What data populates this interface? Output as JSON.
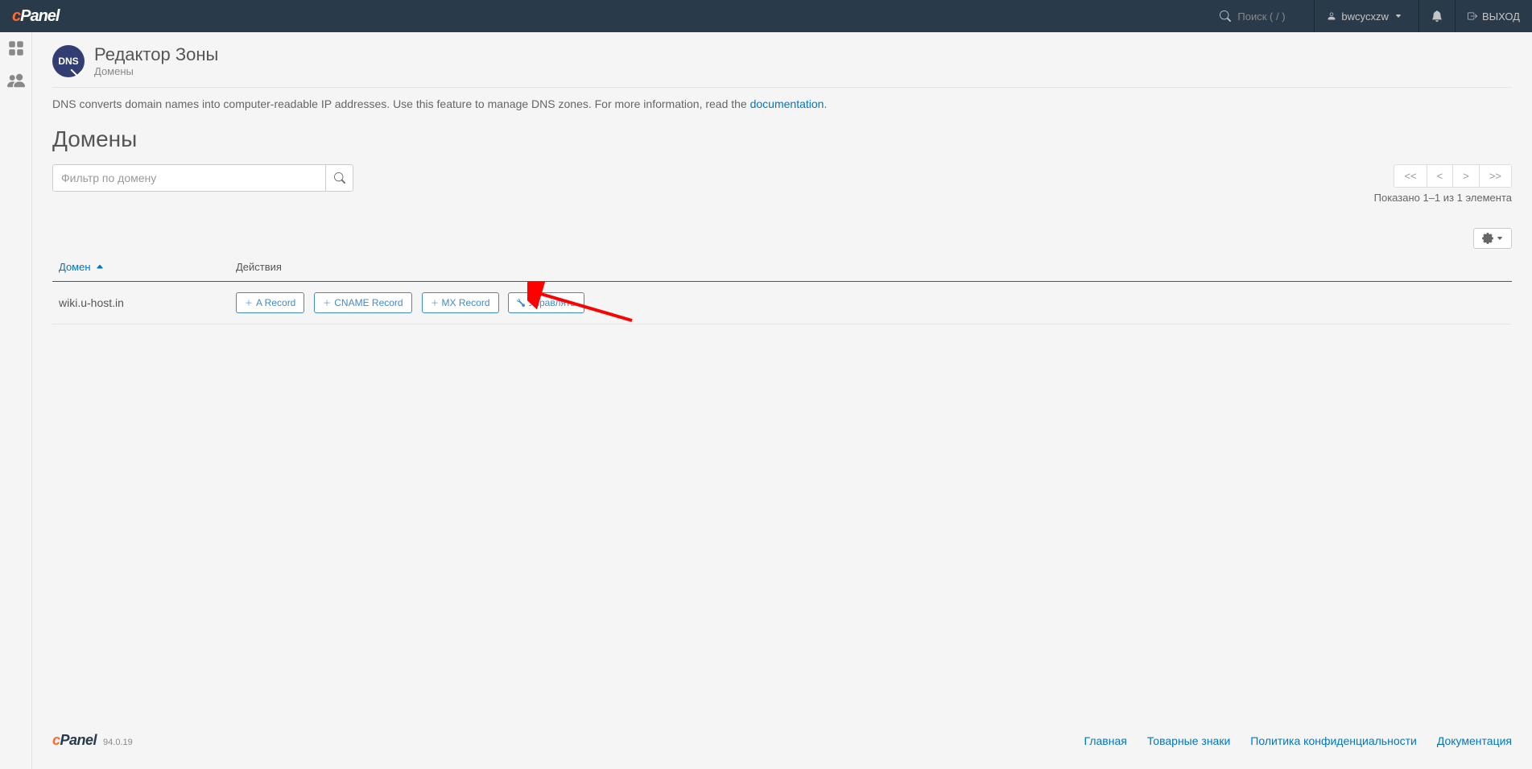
{
  "header": {
    "search_placeholder": "Поиск ( / )",
    "username": "bwcycxzw",
    "logout": "ВЫХОД"
  },
  "page": {
    "title": "Редактор Зоны",
    "breadcrumb": "Домены",
    "description_prefix": "DNS converts domain names into computer-readable IP addresses. Use this feature to manage DNS zones. For more information, read the ",
    "documentation_link": "documentation",
    "description_suffix": "."
  },
  "section": {
    "title": "Домены"
  },
  "filter": {
    "placeholder": "Фильтр по домену"
  },
  "pagination": {
    "first": "<<",
    "prev": "<",
    "next": ">",
    "last": ">>",
    "info": "Показано 1–1 из 1 элемента"
  },
  "table": {
    "col_domain": "Домен",
    "col_actions": "Действия",
    "rows": [
      {
        "domain": "wiki.u-host.in",
        "a_record": "A Record",
        "cname_record": "CNAME Record",
        "mx_record": "MX Record",
        "manage": "Управлять"
      }
    ]
  },
  "footer": {
    "version": "94.0.19",
    "links": {
      "home": "Главная",
      "trademarks": "Товарные знаки",
      "privacy": "Политика конфиденциальности",
      "docs": "Документация"
    }
  }
}
